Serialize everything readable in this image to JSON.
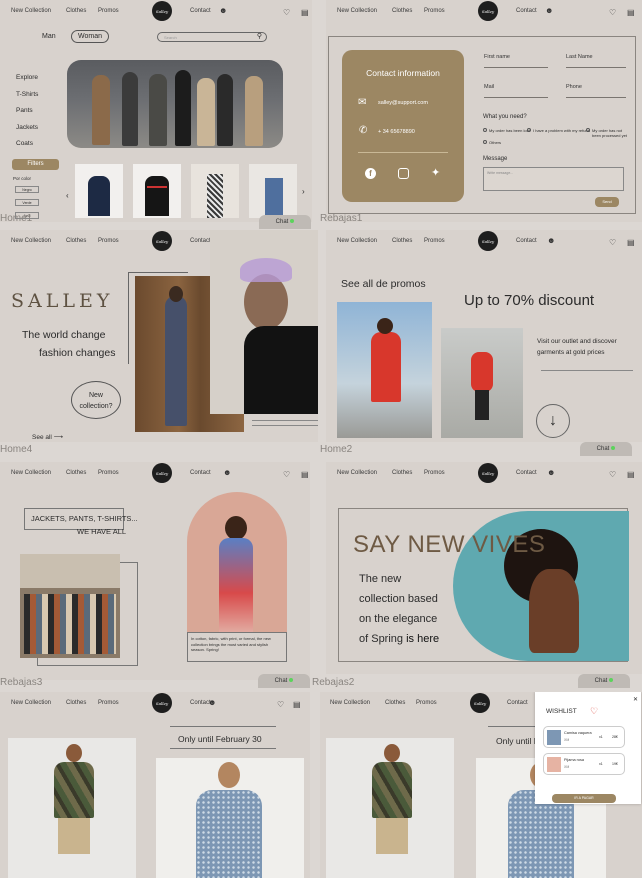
{
  "nav": {
    "new_collection": "New Collection",
    "clothes": "Clothes",
    "promos": "Promos",
    "contact": "Contact",
    "logo": "Salley"
  },
  "frame_labels": {
    "home1": "Home1",
    "rebajas1": "Rebajas1",
    "home4": "Home4",
    "home2": "Home2",
    "rebajas3": "Rebajas3",
    "rebajas2": "Rebajas2"
  },
  "home1": {
    "gender_man": "Man",
    "gender_woman": "Woman",
    "search_placeholder": "Search",
    "sidebar": [
      "Explore",
      "T-Shirts",
      "Pants",
      "Jackets",
      "Coats"
    ],
    "filters": "Filters",
    "color_label": "Por color",
    "color_options": [
      "Negro",
      "Verde",
      "Azul"
    ]
  },
  "rebajas1": {
    "card_title": "Contact information",
    "email": "salley@support.com",
    "phone": "+ 34 65678890",
    "first_name": "First name",
    "last_name": "Last Name",
    "mail": "Mail",
    "phone_label": "Phone",
    "need_title": "What you need?",
    "options": [
      "My order has been lost",
      "I have a problem with my refund",
      "My order has not been processed yet",
      "Others"
    ],
    "message": "Message",
    "message_placeholder": "Write message...",
    "send": "Send"
  },
  "home4": {
    "brand": "SALLEY",
    "line1": "The world change",
    "line2": "fashion changes",
    "bubble1": "New",
    "bubble2": "collection?",
    "see_all": "See all"
  },
  "home2": {
    "promos": "See all de promos",
    "discount": "Up to 70% discount",
    "desc": "Visit our outlet and discover garments at gold prices"
  },
  "rebajas3": {
    "line1": "JACKETS, PANTS, T-SHIRTS...",
    "line2": "WE HAVE ALL",
    "note": "In cotton, fabric, with print, or formal, the new collection brings the most varied and stylish season. Spring!"
  },
  "rebajas2": {
    "headline": "SAY NEW VIVES",
    "t1": "The new",
    "t2": "collection based",
    "t3": "on the elegance",
    "t4": "of Spring",
    "t5": "is here"
  },
  "bottom": {
    "until": "Only until February 30",
    "until2": "Only until F"
  },
  "wishlist": {
    "title": "WISHLIST",
    "items": [
      {
        "name": "Camisa vaquera",
        "size": "XM",
        "qty": "x1",
        "price": "28€"
      },
      {
        "name": "Pijama rosa",
        "size": "XM",
        "qty": "x1",
        "price": "19€"
      }
    ],
    "cta": "Ir a pagar"
  },
  "chat": "Chat",
  "colors": {
    "gold": "#9c8763",
    "bg": "#d8d2cd",
    "teal": "#5fa9b0",
    "red": "#d8372c"
  }
}
